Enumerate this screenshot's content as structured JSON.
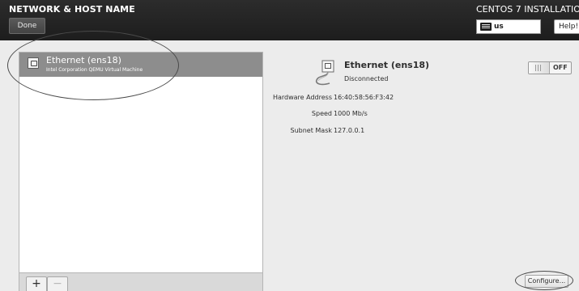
{
  "header": {
    "page_title": "NETWORK & HOST NAME",
    "done_label": "Done",
    "product_title": "CENTOS 7 INSTALLATION",
    "keyboard_layout": "us",
    "help_label": "Help!"
  },
  "device_list": {
    "items": [
      {
        "name": "Ethernet (ens18)",
        "description": "Intel Corporation QEMU Virtual Machine",
        "selected": true
      }
    ],
    "add_label": "+",
    "remove_label": "−"
  },
  "device_detail": {
    "name": "Ethernet (ens18)",
    "status": "Disconnected",
    "toggle_state": "OFF",
    "hardware_address_label": "Hardware Address",
    "hardware_address_value": "16:40:58:56:F3:42",
    "speed_label": "Speed",
    "speed_value": "1000 Mb/s",
    "subnet_mask_label": "Subnet Mask",
    "subnet_mask_value": "127.0.0.1",
    "configure_label": "Configure..."
  },
  "icons": {
    "device_icon": "ethernet-icon",
    "detail_icon": "ethernet-cable-icon",
    "keyboard_icon": "keyboard-icon"
  },
  "colors": {
    "header_bg": "#1f1f1f",
    "selected_row_bg": "#8d8d8d",
    "page_bg": "#ececec"
  }
}
